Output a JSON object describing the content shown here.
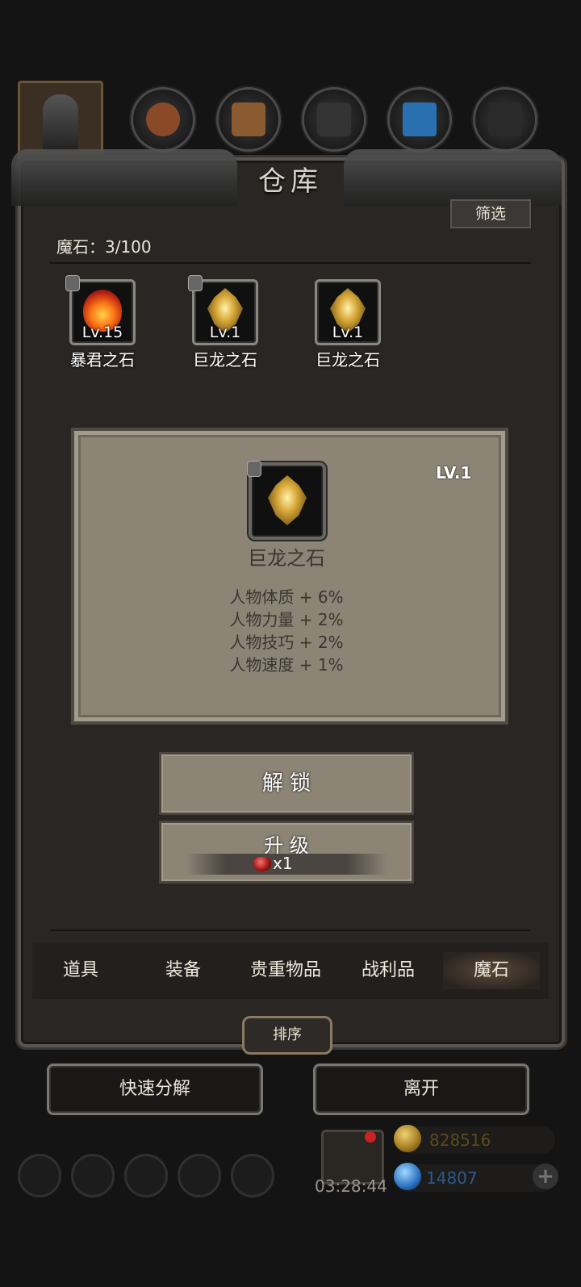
{
  "panel": {
    "title": "仓库",
    "filter_label": "筛选"
  },
  "stone_count": {
    "label": "魔石：3/100"
  },
  "stones": [
    {
      "level": "Lv.15",
      "name": "暴君之石"
    },
    {
      "level": "Lv.1",
      "name": "巨龙之石"
    },
    {
      "level": "Lv.1",
      "name": "巨龙之石"
    }
  ],
  "detail": {
    "level": "LV.1",
    "name": "巨龙之石",
    "attributes": [
      "人物体质 + 6%",
      "人物力量 + 2%",
      "人物技巧 + 2%",
      "人物速度 + 1%"
    ]
  },
  "actions": {
    "unlock_label": "解 锁",
    "upgrade_label": "升 级",
    "upgrade_cost": "x1"
  },
  "tabs": [
    "道具",
    "装备",
    "贵重物品",
    "战利品",
    "魔石"
  ],
  "sort_label": "排序",
  "bottom": {
    "decompose_label": "快速分解",
    "leave_label": "离开"
  },
  "hud": {
    "timer": "03:28:44",
    "gold": "828516",
    "gems": "14807"
  },
  "colors": {
    "panel": "#2a2623",
    "card": "#8c8475",
    "gold_text": "#5a4a20",
    "gem_text": "#2a5a8a"
  }
}
